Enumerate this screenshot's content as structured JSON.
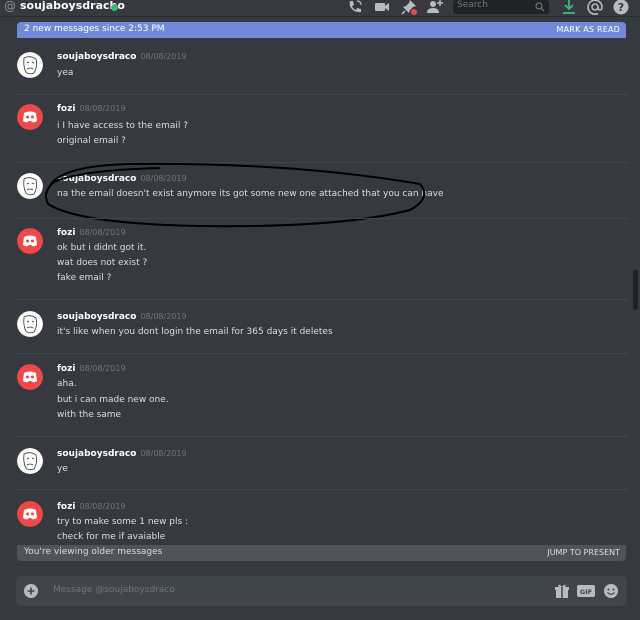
{
  "header": {
    "at_symbol": "@",
    "username": "soujaboysdracho",
    "status_color": "#43b581",
    "search_placeholder": "Search",
    "icons": [
      "phone-call-icon",
      "video-call-icon",
      "pin-icon",
      "add-user-icon",
      "search-icon",
      "download-icon",
      "mention-icon",
      "help-icon"
    ]
  },
  "banner": {
    "text": "2 new messages since 2:53 PM",
    "action": "MARK AS READ",
    "color": "#7289da"
  },
  "messages": [
    {
      "author": "soujaboysdraco",
      "timestamp": "08/08/2019",
      "avatar": "rage-face-avatar",
      "lines": [
        "yea"
      ]
    },
    {
      "author": "fozi",
      "timestamp": "08/08/2019",
      "avatar": "discord-logo-avatar",
      "lines": [
        "i I have access to the email ?",
        "original email ?"
      ]
    },
    {
      "author": "soujaboysdraco",
      "timestamp": "08/08/2019",
      "avatar": "rage-face-avatar",
      "lines": [
        "na the email doesn't exist anymore its got some new one attached that you can have"
      ]
    },
    {
      "author": "fozi",
      "timestamp": "08/08/2019",
      "avatar": "discord-logo-avatar",
      "lines": [
        "ok but i didnt got it.",
        "wat does not exist ?",
        "fake email ?"
      ]
    },
    {
      "author": "soujaboysdraco",
      "timestamp": "08/08/2019",
      "avatar": "rage-face-avatar",
      "lines": [
        "it's like when you dont login the email for 365 days it deletes"
      ]
    },
    {
      "author": "fozi",
      "timestamp": "08/08/2019",
      "avatar": "discord-logo-avatar",
      "lines": [
        "aha.",
        "but i can made new one.",
        "with the same"
      ]
    },
    {
      "author": "soujaboysdraco",
      "timestamp": "08/08/2019",
      "avatar": "rage-face-avatar",
      "lines": [
        "ye"
      ]
    },
    {
      "author": "fozi",
      "timestamp": "08/08/2019",
      "avatar": "discord-logo-avatar",
      "lines": [
        "try to make some 1 new pls :",
        "check for me if avaiable"
      ]
    }
  ],
  "older_bar": {
    "text": "You're viewing older messages",
    "action": "JUMP TO PRESENT"
  },
  "composer": {
    "placeholder": "Message @soujaboysdraco",
    "icons": [
      "add-attachment-icon",
      "gift-icon",
      "gif-icon",
      "emoji-icon"
    ]
  },
  "colors": {
    "background": "#36393f",
    "discord_red": "#f04747",
    "download_green": "#43b581"
  }
}
